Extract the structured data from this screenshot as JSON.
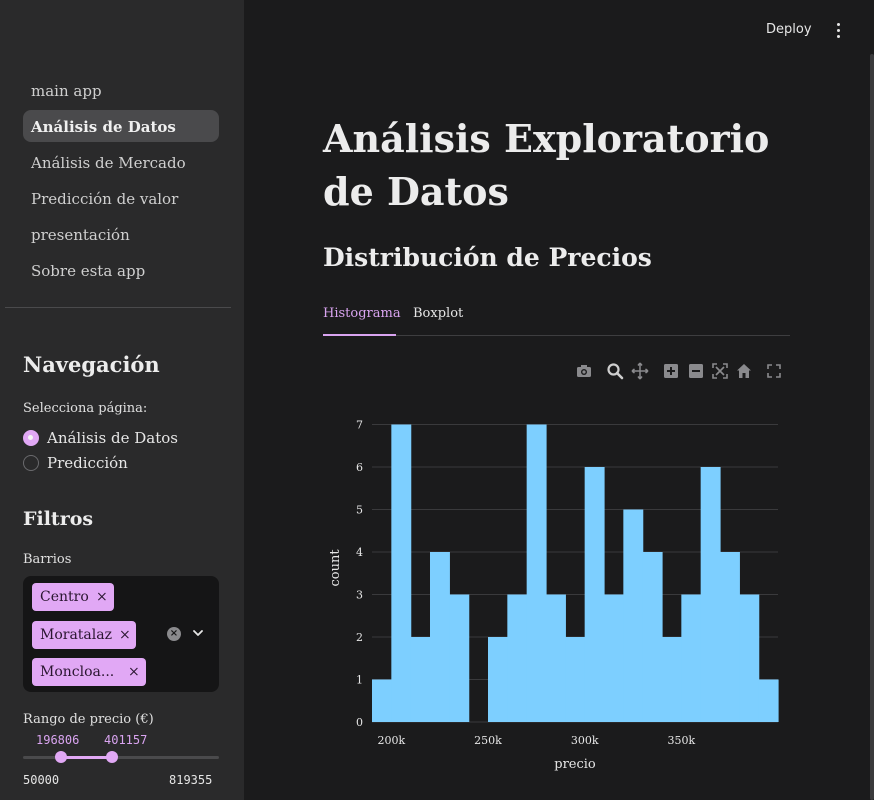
{
  "header": {
    "deploy_label": "Deploy"
  },
  "sidebar": {
    "nav_items": [
      {
        "label": "main app",
        "active": false
      },
      {
        "label": "Análisis de Datos",
        "active": true
      },
      {
        "label": "Análisis de Mercado",
        "active": false
      },
      {
        "label": "Predicción de valor",
        "active": false
      },
      {
        "label": "presentación",
        "active": false
      },
      {
        "label": "Sobre esta app",
        "active": false
      }
    ],
    "navigation": {
      "heading": "Navegación",
      "radio_label": "Selecciona página:",
      "options": [
        "Análisis de Datos",
        "Predicción"
      ],
      "selected": "Análisis de Datos"
    },
    "filters": {
      "heading": "Filtros",
      "barrios_label": "Barrios",
      "barrios_selected": [
        "Centro",
        "Moratalaz",
        "Moncloa..."
      ],
      "price_label": "Rango de precio (€)",
      "price_low": "196806",
      "price_high": "401157",
      "price_min": "50000",
      "price_max": "819355"
    }
  },
  "main": {
    "title": "Análisis Exploratorio de Datos",
    "subtitle": "Distribución de Precios",
    "tabs": [
      {
        "label": "Histograma",
        "active": true
      },
      {
        "label": "Boxplot",
        "active": false
      }
    ],
    "toolbar_icons": [
      "camera-icon",
      "zoom-icon",
      "pan-icon",
      "zoom-in-icon",
      "zoom-out-icon",
      "autoscale-icon",
      "reset-axes-icon",
      "fullscreen-icon"
    ]
  },
  "colors": {
    "accent": "#e1a8f5",
    "bar": "#7dcfff",
    "background": "#1b1b1c",
    "sidebar": "#2a2a2b"
  },
  "chart_data": {
    "type": "bar",
    "title": "",
    "xlabel": "precio",
    "ylabel": "count",
    "x_start": 190000,
    "bin_width": 10000,
    "counts": [
      1,
      7,
      2,
      4,
      3,
      0,
      2,
      3,
      7,
      3,
      2,
      6,
      3,
      5,
      4,
      2,
      3,
      6,
      4,
      3,
      1
    ],
    "xlim": [
      190000,
      400000
    ],
    "ylim": [
      0,
      7.2
    ],
    "x_ticks": [
      200000,
      250000,
      300000,
      350000
    ],
    "x_tick_labels": [
      "200k",
      "250k",
      "300k",
      "350k"
    ],
    "y_ticks": [
      0,
      1,
      2,
      3,
      4,
      5,
      6,
      7
    ],
    "grid": true
  }
}
